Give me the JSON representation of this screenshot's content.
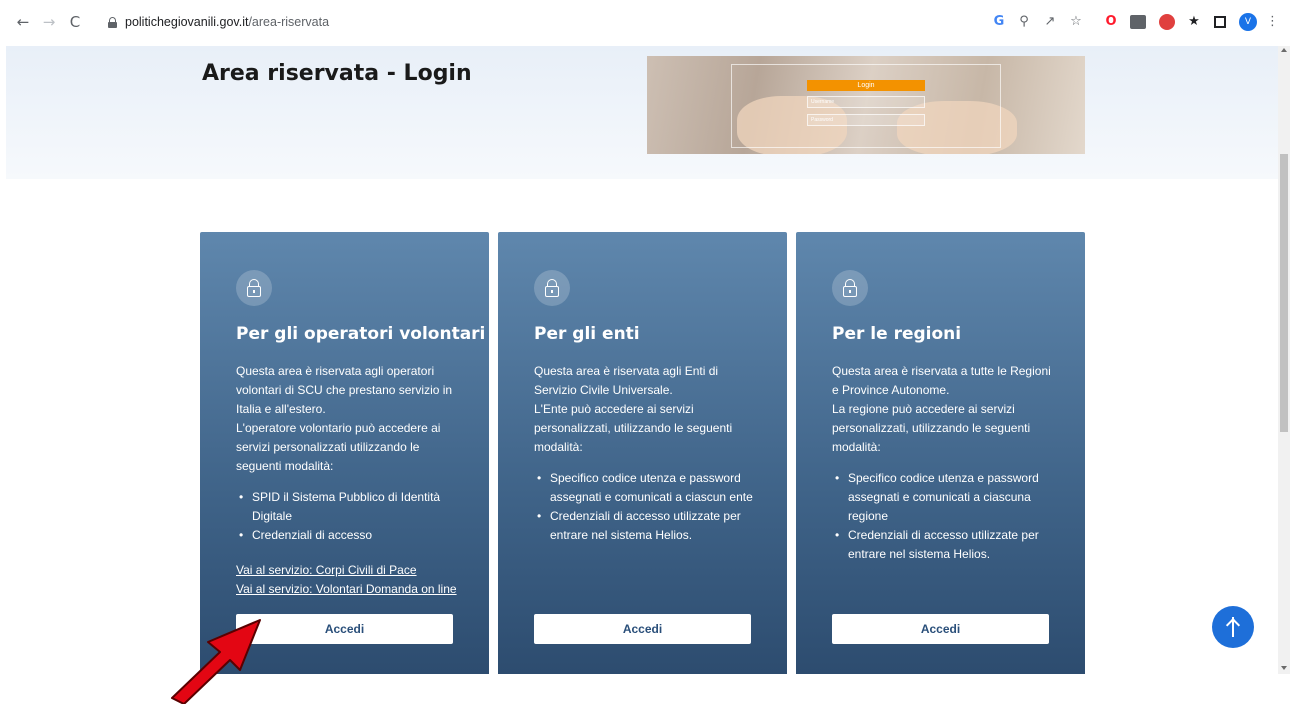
{
  "browser": {
    "url_host": "politichegiovanili.gov.it",
    "url_path": "/area-riservata",
    "back_icon": "←",
    "forward_icon": "→",
    "reload_icon": "C"
  },
  "page": {
    "title": "Area riservata - Login",
    "hero_image": {
      "login_label": "Login",
      "username_label": "Username",
      "password_label": "Password"
    }
  },
  "cards": [
    {
      "title": "Per gli operatori volontari",
      "paragraphs": [
        "Questa area è riservata agli operatori volontari di SCU che prestano servizio in Italia e all'estero.",
        "L'operatore volontario può accedere ai servizi personalizzati utilizzando le seguenti modalità:"
      ],
      "bullets": [
        "SPID il Sistema Pubblico di Identità Digitale",
        "Credenziali di accesso"
      ],
      "links": [
        "Vai al servizio: Corpi Civili di Pace",
        "Vai al servizio: Volontari Domanda on line"
      ],
      "button_label": "Accedi"
    },
    {
      "title": "Per gli enti",
      "paragraphs": [
        "Questa area è riservata agli Enti di Servizio Civile Universale.",
        "L'Ente può accedere ai servizi personalizzati, utilizzando le seguenti modalità:"
      ],
      "bullets": [
        "Specifico codice utenza e password assegnati e comunicati a ciascun ente",
        "Credenziali di accesso utilizzate per entrare nel sistema Helios."
      ],
      "button_label": "Accedi"
    },
    {
      "title": "Per le regioni",
      "paragraphs": [
        "Questa area è riservata a tutte le Regioni e Province Autonome.",
        "La regione può accedere ai servizi personalizzati, utilizzando le seguenti modalità:"
      ],
      "bullets": [
        "Specifico codice utenza e password assegnati e comunicati a ciascuna regione",
        "Credenziali di accesso utilizzate per entrare nel sistema Helios."
      ],
      "button_label": "Accedi"
    }
  ],
  "colors": {
    "card_top": "#5f87ad",
    "card_bottom": "#2c4b6e",
    "button_text": "#2a4f7a",
    "scroll_top_button": "#1e6fd9",
    "annotation_arrow": "#e30613"
  },
  "icons": {
    "card_icon": "lock-icon",
    "scroll_top": "arrow-up-icon",
    "annotation": "red-arrow-icon"
  }
}
